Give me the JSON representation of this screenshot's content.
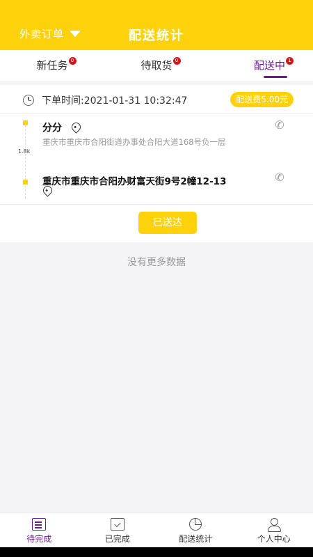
{
  "header": {
    "dropdown_label": "外卖订单",
    "title": "配送统计"
  },
  "tabs": [
    {
      "label": "新任务",
      "badge": "0"
    },
    {
      "label": "待取货",
      "badge": "0"
    },
    {
      "label": "配送中",
      "badge": "1",
      "active": true
    }
  ],
  "order": {
    "order_time": "下单时间:2021-01-31 10:32:47",
    "fee": "配送费5.00元",
    "distance": "1.8k",
    "shop_name": "分分",
    "shop_address": "重庆市重庆市合阳街道办事处合阳大道168号负一层",
    "customer_address": "重庆市重庆市合阳办财富天街9号2幢12-13",
    "delivered_label": "已送达"
  },
  "list_end_text": "没有更多数据",
  "bottom_nav": [
    {
      "label": "待完成",
      "icon": "document-icon",
      "active": true
    },
    {
      "label": "已完成",
      "icon": "completed-icon"
    },
    {
      "label": "配送统计",
      "icon": "pie-chart-icon"
    },
    {
      "label": "个人中心",
      "icon": "user-icon"
    }
  ],
  "colors": {
    "brand_yellow": "#fed20b",
    "accent_purple": "#6d1b8c",
    "badge_red": "#d4161e"
  }
}
